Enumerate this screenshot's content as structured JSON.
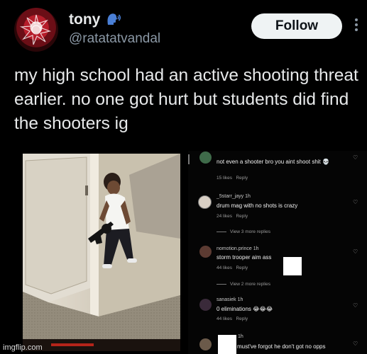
{
  "tweet": {
    "display_name": "tony",
    "name_emoji_icon": "speaking-head-icon",
    "handle": "@ratatatvandal",
    "follow_label": "Follow",
    "text": "my high school had an active shooting threat earlier. no one got hurt but students did find the shooters ig"
  },
  "comments": [
    {
      "user": "",
      "text": "not even a shooter bro you aint shoot shit 💀",
      "likes": "15 likes",
      "reply": "Reply"
    },
    {
      "user": "_5starr_jayy 1h",
      "text": "drum mag with no shots is crazy",
      "likes": "24 likes",
      "reply": "Reply",
      "view_more": "View 3 more replies"
    },
    {
      "user": "nomotion.prince 1h",
      "text": "storm trooper aim ass",
      "likes": "44 likes",
      "reply": "Reply",
      "view_more": "View 2 more replies"
    },
    {
      "user": "sanasiek 1h",
      "text": "0 eliminations 😂😂😂",
      "likes": "44 likes",
      "reply": "Reply"
    },
    {
      "user": "1h",
      "text": "must've forgot he don't got no opps"
    }
  ],
  "watermark": "imgflip.com",
  "colors": {
    "background": "#000000",
    "follow_bg": "#eff3f4",
    "handle": "#8b98a5"
  }
}
